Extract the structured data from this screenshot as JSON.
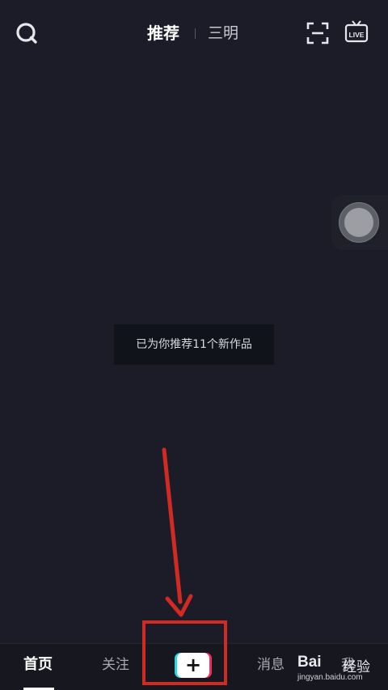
{
  "top_tabs": {
    "recommend": "推荐",
    "location": "三明"
  },
  "icons": {
    "search": "search-icon",
    "scan": "scan-icon",
    "live": "live-icon"
  },
  "live_label": "LIVE",
  "toast_text": "已为你推荐11个新作品",
  "bottom_nav": {
    "home": "首页",
    "follow": "关注",
    "create": "+",
    "messages": "消息",
    "me": "我"
  },
  "watermark": {
    "brand": "Bai",
    "brand_suffix": "经验",
    "url": "jingyan.baidu.com"
  },
  "colors": {
    "background": "#1b1c28",
    "annotation": "#d02a22",
    "create_cyan": "#25d9e6",
    "create_pink": "#f52d58"
  }
}
